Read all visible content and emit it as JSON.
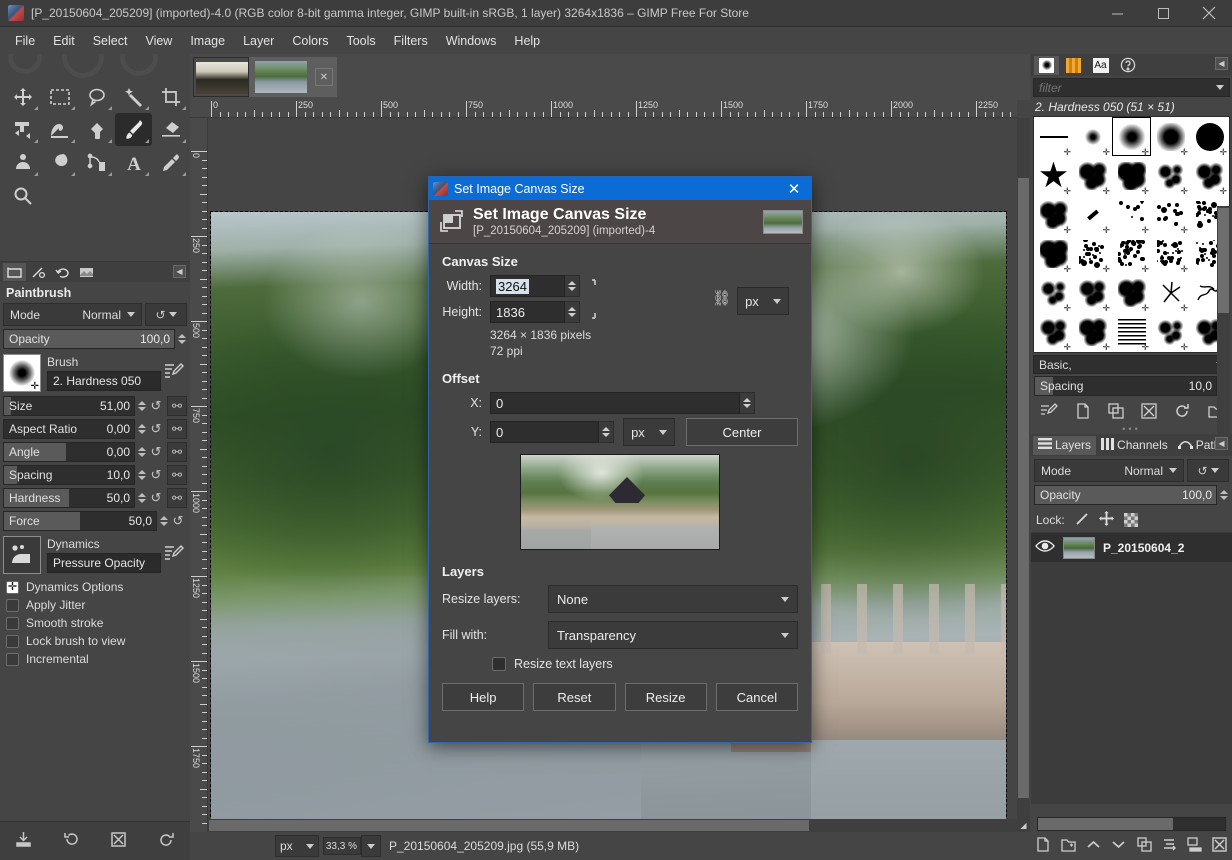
{
  "window": {
    "title": "[P_20150604_205209] (imported)-4.0 (RGB color 8-bit gamma integer, GIMP built-in sRGB, 1 layer) 3264x1836 – GIMP Free For Store",
    "app_icon": "gimp-wilber-icon",
    "minimize": "–",
    "maximize": "□",
    "close": "✕"
  },
  "menubar": {
    "items": [
      {
        "label": "File"
      },
      {
        "label": "Edit"
      },
      {
        "label": "Select"
      },
      {
        "label": "View"
      },
      {
        "label": "Image"
      },
      {
        "label": "Layer"
      },
      {
        "label": "Colors"
      },
      {
        "label": "Tools"
      },
      {
        "label": "Filters"
      },
      {
        "label": "Windows"
      },
      {
        "label": "Help"
      }
    ]
  },
  "toolbox": {
    "tools": [
      {
        "name": "move-tool"
      },
      {
        "name": "rectangle-select-tool"
      },
      {
        "name": "free-select-tool"
      },
      {
        "name": "fuzzy-select-tool"
      },
      {
        "name": "crop-tool"
      },
      {
        "name": "unified-transform-tool"
      },
      {
        "name": "warp-transform-tool"
      },
      {
        "name": "bucket-fill-tool"
      },
      {
        "name": "paintbrush-tool"
      },
      {
        "name": "eraser-tool"
      },
      {
        "name": "smudge-tool"
      },
      {
        "name": "blur-sharpen-tool"
      },
      {
        "name": "clone-tool"
      },
      {
        "name": "text-tool"
      },
      {
        "name": "color-picker-tool"
      },
      {
        "name": "zoom-tool"
      }
    ],
    "active_tool": "paintbrush-tool",
    "foreground_color": "#000000",
    "background_color": "#ffffff"
  },
  "tool_options": {
    "dock_tabs": [
      "tool-options-tab",
      "device-status-tab",
      "undo-history-tab",
      "images-tab"
    ],
    "title": "Paintbrush",
    "mode": {
      "label": "Mode",
      "value": "Normal"
    },
    "opacity": {
      "label": "Opacity",
      "value": "100,0",
      "percent": 100
    },
    "brush": {
      "caption": "Brush",
      "value": "2. Hardness 050"
    },
    "sliders": [
      {
        "label": "Size",
        "value": "51,00",
        "percent": 5,
        "pin": true
      },
      {
        "label": "Aspect Ratio",
        "value": "0,00",
        "percent": 50,
        "pin": true
      },
      {
        "label": "Angle",
        "value": "0,00",
        "percent": 50,
        "pin": true
      },
      {
        "label": "Spacing",
        "value": "10,0",
        "percent": 10,
        "pin": true
      },
      {
        "label": "Hardness",
        "value": "50,0",
        "percent": 50,
        "pin": true
      },
      {
        "label": "Force",
        "value": "50,0",
        "percent": 50,
        "pin": false
      }
    ],
    "dynamics": {
      "caption": "Dynamics",
      "value": "Pressure Opacity"
    },
    "checkboxes": [
      {
        "label": "Dynamics Options",
        "checked": true
      },
      {
        "label": "Apply Jitter",
        "checked": false
      },
      {
        "label": "Smooth stroke",
        "checked": false
      },
      {
        "label": "Lock brush to view",
        "checked": false
      },
      {
        "label": "Incremental",
        "checked": false
      }
    ]
  },
  "toolbox_bottom": {
    "buttons": [
      "save-tool-options-icon",
      "restore-tool-options-icon",
      "delete-tool-options-icon",
      "reset-tool-options-icon"
    ]
  },
  "canvas": {
    "tabs": [
      {
        "name": "image-thumb-tab-1",
        "selected": false
      },
      {
        "name": "image-thumb-tab-2",
        "selected": true
      }
    ],
    "tab_close": "✕",
    "ruler_h_labels": [
      "0",
      "250",
      "500",
      "750",
      "1000",
      "1250",
      "1500",
      "1750",
      "2000",
      "2250"
    ],
    "ruler_v_labels": [
      "0",
      "250",
      "500",
      "750",
      "1000",
      "1250",
      "1500",
      "1750"
    ],
    "quick_mask_icon": "quick-mask-toggle",
    "nav_icon": "navigation-preview-icon"
  },
  "statusbar": {
    "unit": "px",
    "zoom": "33,3 %",
    "text": "P_20150604_205209.jpg (55,9 MB)"
  },
  "right_dock": {
    "top_tabs": [
      "brushes-tab",
      "patterns-tab",
      "fonts-tab",
      "document-history-tab"
    ],
    "filter_placeholder": "filter",
    "selected_brush": "2. Hardness 050 (51 × 51)",
    "tag_value": "Basic,",
    "spacing": {
      "label": "Spacing",
      "value": "10,0",
      "percent": 10
    },
    "brush_buttons": [
      "edit-brush-icon",
      "new-brush-icon",
      "duplicate-brush-icon",
      "delete-brush-icon",
      "refresh-brushes-icon",
      "open-brush-as-image-icon"
    ],
    "layers_tabs": [
      {
        "label": "Layers",
        "icon": "layers-icon",
        "selected": true
      },
      {
        "label": "Channels",
        "icon": "channels-icon",
        "selected": false
      },
      {
        "label": "Paths",
        "icon": "paths-icon",
        "selected": false
      }
    ],
    "layer_mode": {
      "label": "Mode",
      "value": "Normal"
    },
    "layer_opacity": {
      "label": "Opacity",
      "value": "100,0",
      "percent": 100
    },
    "lock": {
      "label": "Lock:",
      "icons": [
        "lock-pixels-icon",
        "lock-position-icon",
        "lock-alpha-icon"
      ]
    },
    "layers": [
      {
        "name": "P_20150604_2",
        "visible": true
      }
    ],
    "bottom_buttons": [
      "new-layer-icon",
      "new-layer-group-icon",
      "raise-layer-icon",
      "lower-layer-icon",
      "duplicate-layer-icon",
      "anchor-layer-icon",
      "merge-down-icon",
      "delete-layer-icon"
    ]
  },
  "dialog": {
    "titlebar": "Set Image Canvas Size",
    "close": "✕",
    "heading": "Set Image Canvas Size",
    "subheading": "[P_20150604_205209] (imported)-4",
    "canvas_size": {
      "section": "Canvas Size",
      "width": {
        "label": "Width:",
        "value": "3264",
        "selected": true
      },
      "height": {
        "label": "Height:",
        "value": "1836",
        "selected": false
      },
      "unit": "px",
      "info_pixels": "3264 × 1836 pixels",
      "info_ppi": "72 ppi"
    },
    "offset": {
      "section": "Offset",
      "x": {
        "label": "X:",
        "value": "0"
      },
      "y": {
        "label": "Y:",
        "value": "0"
      },
      "unit": "px",
      "center_button": "Center"
    },
    "layers": {
      "section": "Layers",
      "resize_layers": {
        "label": "Resize layers:",
        "value": "None"
      },
      "fill_with": {
        "label": "Fill with:",
        "value": "Transparency"
      },
      "resize_text_layers": {
        "label": "Resize text layers",
        "checked": false
      }
    },
    "buttons": [
      {
        "label": "Help",
        "name": "help-button"
      },
      {
        "label": "Reset",
        "name": "reset-button"
      },
      {
        "label": "Resize",
        "name": "resize-button"
      },
      {
        "label": "Cancel",
        "name": "cancel-button"
      }
    ]
  },
  "colors": {
    "dialog_titlebar_blue": "#0a6cd4",
    "panel_gray": "#454545",
    "field_dark": "#2e2e2e",
    "text_light": "#e4e4e4"
  }
}
